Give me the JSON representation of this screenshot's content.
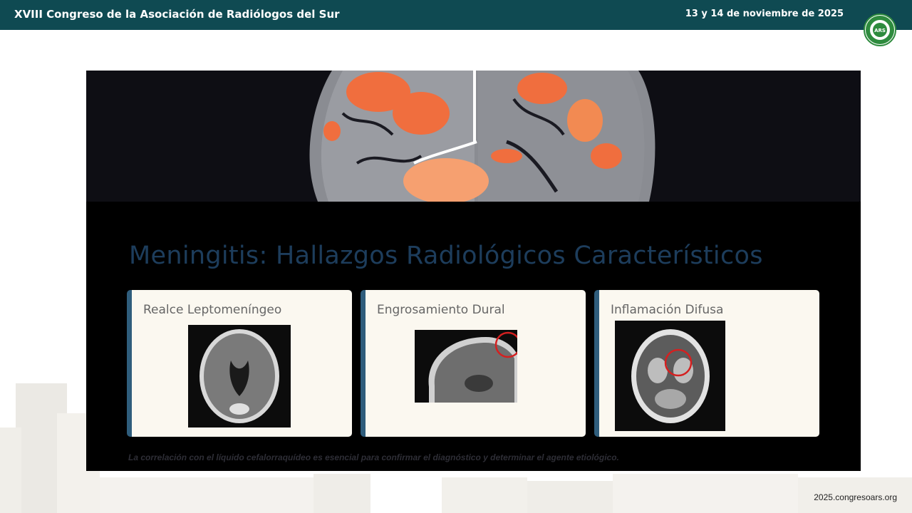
{
  "header": {
    "title": "XVIII Congreso de la Asociación de Radiólogos del Sur",
    "date": "13 y 14 de noviembre de 2025",
    "logo_text": "ARS",
    "bg_color": "#0f4a52"
  },
  "slide": {
    "title": "Meningitis: Hallazgos Radiológicos Característicos",
    "cards": [
      {
        "title": "Realce Leptomeníngeo"
      },
      {
        "title": "Engrosamiento Dural"
      },
      {
        "title": "Inflamación Difusa"
      }
    ],
    "footnote": "La correlación con el líquido cefalorraquídeo es esencial para confirmar el diagnóstico y determinar el agente etiológico."
  },
  "footer": {
    "url": "2025.congresoars.org"
  }
}
